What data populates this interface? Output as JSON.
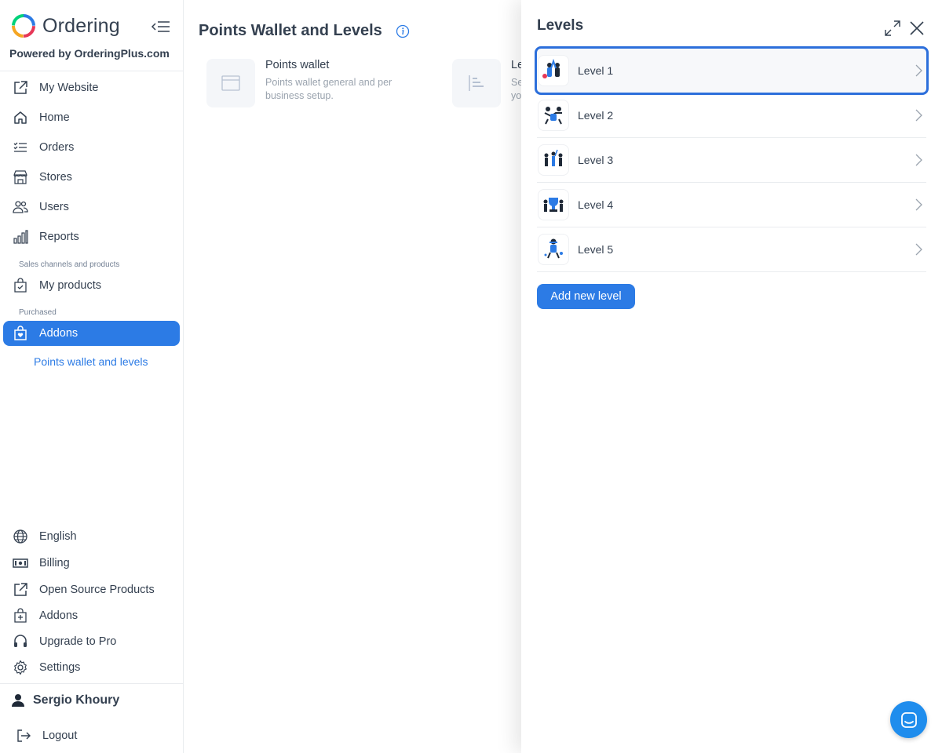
{
  "brand": {
    "name": "Ordering",
    "powered_by": "Powered by OrderingPlus.com"
  },
  "sidebar": {
    "items": [
      {
        "label": "My Website",
        "icon": "external-link-icon"
      },
      {
        "label": "Home",
        "icon": "home-icon"
      },
      {
        "label": "Orders",
        "icon": "list-check-icon"
      },
      {
        "label": "Stores",
        "icon": "shop-icon"
      },
      {
        "label": "Users",
        "icon": "people-icon"
      },
      {
        "label": "Reports",
        "icon": "bar-chart-icon"
      }
    ],
    "section_sales": "Sales channels and products",
    "my_products": "My products",
    "section_purchased": "Purchased",
    "addons_active": "Addons",
    "sub_item": "Points wallet and levels",
    "bottom_items": [
      {
        "label": "English",
        "icon": "globe-icon"
      },
      {
        "label": "Billing",
        "icon": "cash-icon"
      },
      {
        "label": "Open Source Products",
        "icon": "external-link-icon"
      },
      {
        "label": "Addons",
        "icon": "bag-plus-icon"
      },
      {
        "label": "Upgrade to Pro",
        "icon": "headset-icon"
      },
      {
        "label": "Settings",
        "icon": "gear-icon"
      }
    ],
    "user_name": "Sergio Khoury",
    "logout": "Logout"
  },
  "main": {
    "title": "Points Wallet and Levels",
    "cards": [
      {
        "title": "Points wallet",
        "description": "Points wallet general and per business setup."
      },
      {
        "title": "Le",
        "description": "Se\nyo"
      }
    ]
  },
  "drawer": {
    "title": "Levels",
    "levels": [
      "Level 1",
      "Level 2",
      "Level 3",
      "Level 4",
      "Level 5"
    ],
    "selected": "Level 1",
    "add_button": "Add new level"
  },
  "colors": {
    "accent": "#2c7be5",
    "text": "#344050",
    "selected_border": "#2c6fdb",
    "chat": "#1f8ded"
  }
}
